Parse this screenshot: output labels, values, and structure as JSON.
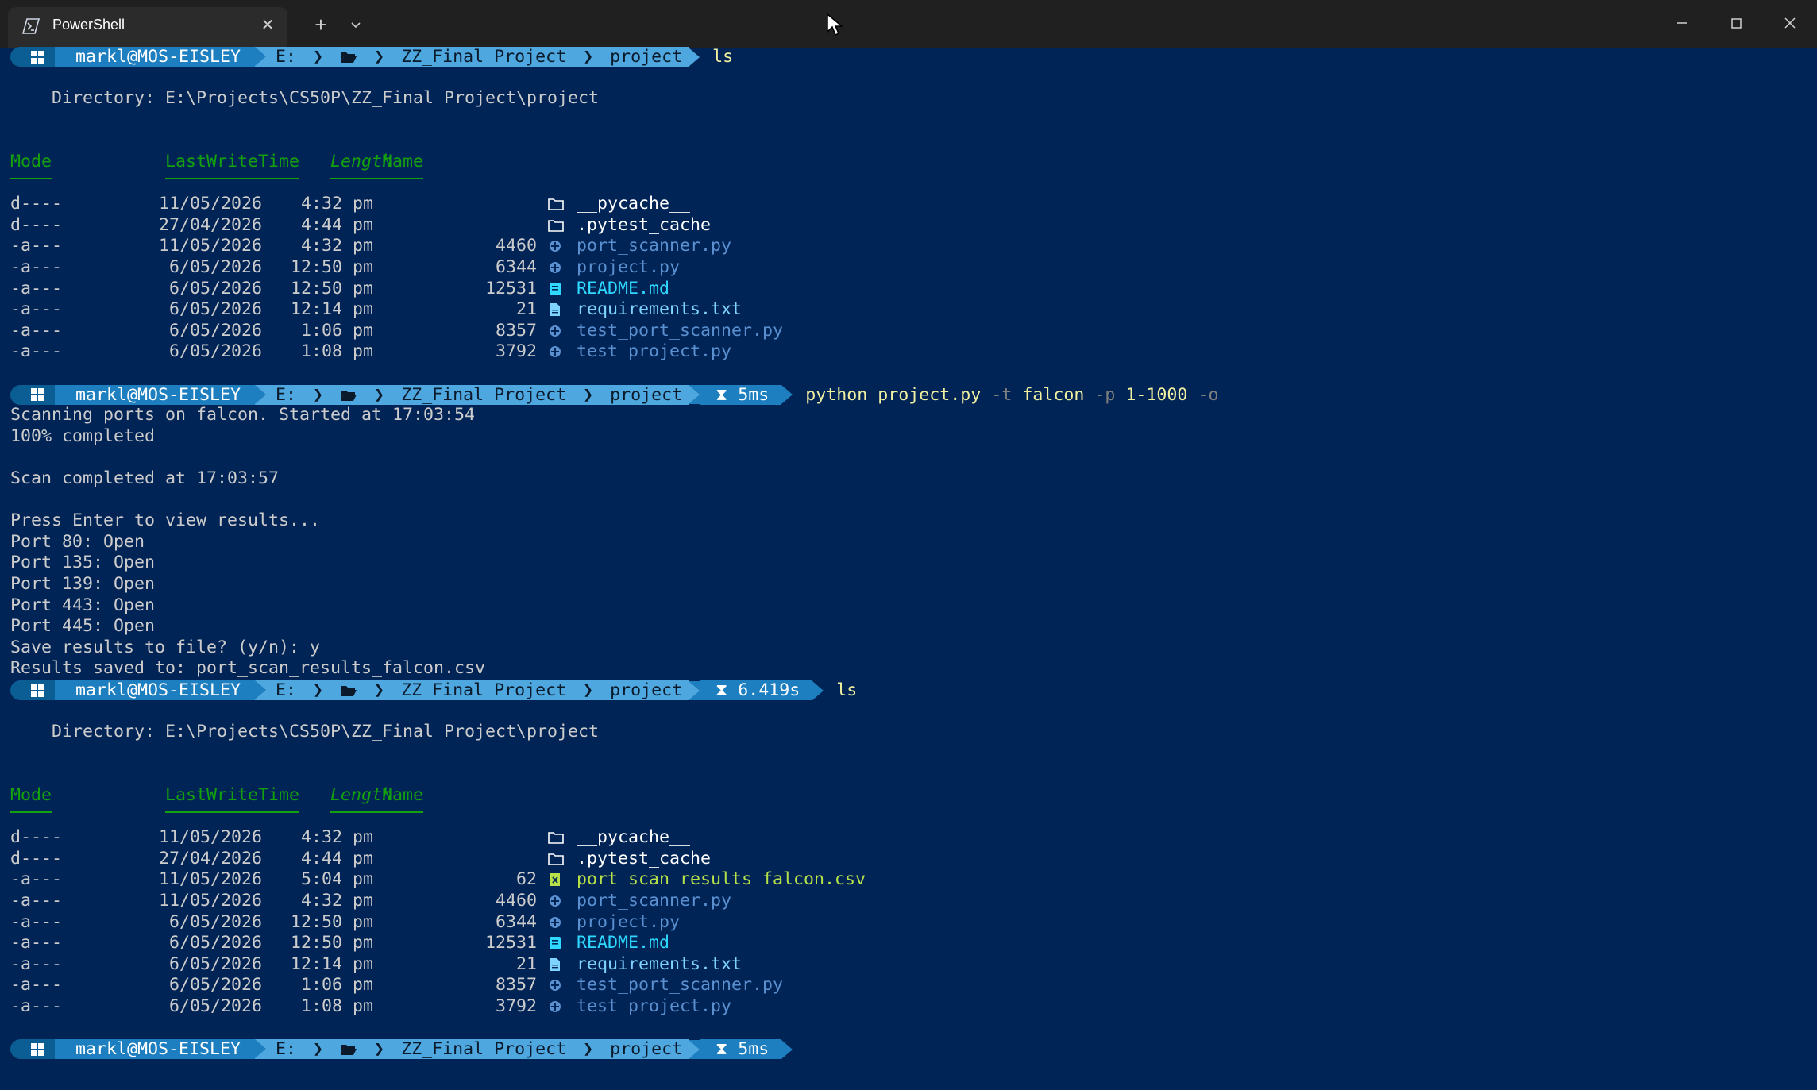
{
  "window": {
    "tab_title": "PowerShell",
    "icons": {
      "tab": "powershell-icon",
      "close": "close-icon",
      "new_tab": "plus-icon",
      "dropdown": "chevron-down-icon",
      "min": "minimize-icon",
      "max": "maximize-icon",
      "win_close": "close-icon"
    }
  },
  "prompt": {
    "user": "markl@MOS-EISLEY",
    "drive": "E:",
    "folder1": "ZZ_Final Project",
    "folder2": "project"
  },
  "session": {
    "cmd1": "ls",
    "directory_line": "    Directory: E:\\Projects\\CS50P\\ZZ_Final Project\\project",
    "headers": {
      "mode": "Mode",
      "lastwrite": "LastWriteTime",
      "length": "Length",
      "name": "Name"
    },
    "listing1": [
      {
        "mode": "d----",
        "date": "11/05/2026",
        "time": "4:32 pm",
        "length": "",
        "name": "__pycache__",
        "type": "dir"
      },
      {
        "mode": "d----",
        "date": "27/04/2026",
        "time": "4:44 pm",
        "length": "",
        "name": ".pytest_cache",
        "type": "dir"
      },
      {
        "mode": "-a---",
        "date": "11/05/2026",
        "time": "4:32 pm",
        "length": "4460",
        "name": "port_scanner.py",
        "type": "py"
      },
      {
        "mode": "-a---",
        "date": "6/05/2026",
        "time": "12:50 pm",
        "length": "6344",
        "name": "project.py",
        "type": "py"
      },
      {
        "mode": "-a---",
        "date": "6/05/2026",
        "time": "12:50 pm",
        "length": "12531",
        "name": "README.md",
        "type": "md"
      },
      {
        "mode": "-a---",
        "date": "6/05/2026",
        "time": "12:14 pm",
        "length": "21",
        "name": "requirements.txt",
        "type": "txt"
      },
      {
        "mode": "-a---",
        "date": "6/05/2026",
        "time": "1:06 pm",
        "length": "8357",
        "name": "test_port_scanner.py",
        "type": "py"
      },
      {
        "mode": "-a---",
        "date": "6/05/2026",
        "time": "1:08 pm",
        "length": "3792",
        "name": "test_project.py",
        "type": "py"
      }
    ],
    "prompt2_time": "5ms",
    "cmd2": {
      "prog": "python project.py",
      "f1": "-t",
      "v1": "falcon",
      "f2": "-p",
      "v2": "1-1000",
      "f3": "-o"
    },
    "output": [
      "Scanning ports on falcon. Started at 17:03:54",
      "100% completed",
      "",
      "Scan completed at 17:03:57",
      "",
      "Press Enter to view results...",
      "Port 80: Open",
      "Port 135: Open",
      "Port 139: Open",
      "Port 443: Open",
      "Port 445: Open",
      "Save results to file? (y/n): y",
      "Results saved to: port_scan_results_falcon.csv"
    ],
    "prompt3_time": "6.419s",
    "cmd3": "ls",
    "listing2": [
      {
        "mode": "d----",
        "date": "11/05/2026",
        "time": "4:32 pm",
        "length": "",
        "name": "__pycache__",
        "type": "dir"
      },
      {
        "mode": "d----",
        "date": "27/04/2026",
        "time": "4:44 pm",
        "length": "",
        "name": ".pytest_cache",
        "type": "dir"
      },
      {
        "mode": "-a---",
        "date": "11/05/2026",
        "time": "5:04 pm",
        "length": "62",
        "name": "port_scan_results_falcon.csv",
        "type": "csv"
      },
      {
        "mode": "-a---",
        "date": "11/05/2026",
        "time": "4:32 pm",
        "length": "4460",
        "name": "port_scanner.py",
        "type": "py"
      },
      {
        "mode": "-a---",
        "date": "6/05/2026",
        "time": "12:50 pm",
        "length": "6344",
        "name": "project.py",
        "type": "py"
      },
      {
        "mode": "-a---",
        "date": "6/05/2026",
        "time": "12:50 pm",
        "length": "12531",
        "name": "README.md",
        "type": "md"
      },
      {
        "mode": "-a---",
        "date": "6/05/2026",
        "time": "12:14 pm",
        "length": "21",
        "name": "requirements.txt",
        "type": "txt"
      },
      {
        "mode": "-a---",
        "date": "6/05/2026",
        "time": "1:06 pm",
        "length": "8357",
        "name": "test_port_scanner.py",
        "type": "py"
      },
      {
        "mode": "-a---",
        "date": "6/05/2026",
        "time": "1:08 pm",
        "length": "3792",
        "name": "test_project.py",
        "type": "py"
      }
    ],
    "prompt4_time": "5ms"
  },
  "colors": {
    "background": "#012456",
    "header_green": "#13a10e",
    "prompt_blue": "#1e7fc0",
    "path_blue": "#4fa7e0"
  }
}
